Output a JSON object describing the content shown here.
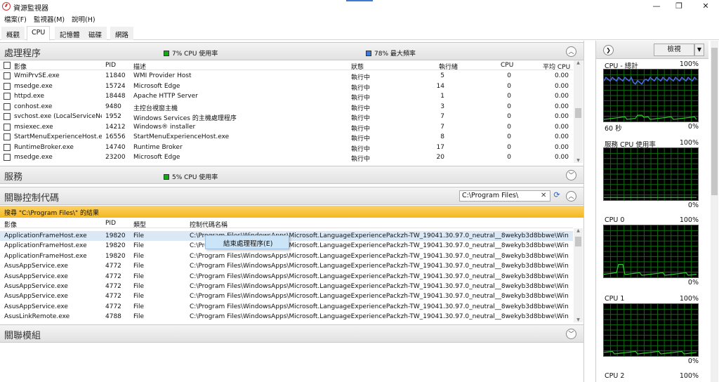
{
  "window": {
    "title": "資源監視器",
    "minimize": "—",
    "maximize": "❐",
    "close": "✕"
  },
  "menu": [
    "檔案(F)",
    "監視器(M)",
    "說明(H)"
  ],
  "tabs": [
    "概觀",
    "CPU",
    "記憶體",
    "磁碟",
    "網路"
  ],
  "processes": {
    "title": "處理程序",
    "cpu_usage": "7% CPU 使用率",
    "max_freq": "78% 最大頻率",
    "cpu_color": "#17a717",
    "freq_color": "#3a7bd5",
    "columns": [
      "影像",
      "PID",
      "描述",
      "狀態",
      "執行緒",
      "CPU",
      "平均 CPU"
    ],
    "rows": [
      [
        "WmiPrvSE.exe",
        "11840",
        "WMI Provider Host",
        "執行中",
        "5",
        "0",
        "0.00"
      ],
      [
        "msedge.exe",
        "15724",
        "Microsoft Edge",
        "執行中",
        "14",
        "0",
        "0.00"
      ],
      [
        "httpd.exe",
        "18448",
        "Apache HTTP Server",
        "執行中",
        "1",
        "0",
        "0.00"
      ],
      [
        "conhost.exe",
        "9480",
        "主控台視窗主機",
        "執行中",
        "3",
        "0",
        "0.00"
      ],
      [
        "svchost.exe (LocalServiceNet...",
        "1952",
        "Windows Services 的主機處理程序",
        "執行中",
        "7",
        "0",
        "0.00"
      ],
      [
        "msiexec.exe",
        "14212",
        "Windows® installer",
        "執行中",
        "7",
        "0",
        "0.00"
      ],
      [
        "StartMenuExperienceHost.exe",
        "16556",
        "StartMenuExperienceHost.exe",
        "執行中",
        "8",
        "0",
        "0.00"
      ],
      [
        "RuntimeBroker.exe",
        "14740",
        "Runtime Broker",
        "執行中",
        "17",
        "0",
        "0.00"
      ],
      [
        "msedge.exe",
        "23200",
        "Microsoft Edge",
        "執行中",
        "20",
        "0",
        "0.00"
      ]
    ]
  },
  "services": {
    "title": "服務",
    "cpu_usage": "5% CPU 使用率"
  },
  "handles": {
    "title": "關聯控制代碼",
    "search_value": "C:\\Program Files\\",
    "clear_icon": "✕",
    "refresh_icon": "⟳",
    "result_text": "搜尋 \"C:\\Program Files\\\" 的結果",
    "columns": [
      "影像",
      "PID",
      "類型",
      "控制代碼名稱"
    ],
    "rows": [
      [
        "ApplicationFrameHost.exe",
        "19820",
        "File",
        "C:\\Program Files\\WindowsApps\\Microsoft.LanguageExperiencePackzh-TW_19041.30.97.0_neutral__8wekyb3d8bbwe\\Windows\\Syste..."
      ],
      [
        "ApplicationFrameHost.exe",
        "19820",
        "File",
        "C:\\Program Files\\WindowsApps\\Microsoft.LanguageExperiencePackzh-TW_19041.30.97.0_neutral__8wekyb3d8bbwe\\Windows\\Syste..."
      ],
      [
        "ApplicationFrameHost.exe",
        "19820",
        "File",
        "C:\\Program Files\\WindowsApps\\Microsoft.LanguageExperiencePackzh-TW_19041.30.97.0_neutral__8wekyb3d8bbwe\\Windows\\Syste..."
      ],
      [
        "AsusAppService.exe",
        "4772",
        "File",
        "C:\\Program Files\\WindowsApps\\Microsoft.LanguageExperiencePackzh-TW_19041.30.97.0_neutral__8wekyb3d8bbwe\\Windows\\Syste..."
      ],
      [
        "AsusAppService.exe",
        "4772",
        "File",
        "C:\\Program Files\\WindowsApps\\Microsoft.LanguageExperiencePackzh-TW_19041.30.97.0_neutral__8wekyb3d8bbwe\\Windows\\Syste..."
      ],
      [
        "AsusAppService.exe",
        "4772",
        "File",
        "C:\\Program Files\\WindowsApps\\Microsoft.LanguageExperiencePackzh-TW_19041.30.97.0_neutral__8wekyb3d8bbwe\\Windows\\Syste..."
      ],
      [
        "AsusAppService.exe",
        "4772",
        "File",
        "C:\\Program Files\\WindowsApps\\Microsoft.LanguageExperiencePackzh-TW_19041.30.97.0_neutral__8wekyb3d8bbwe\\Windows\\Syste..."
      ],
      [
        "AsusAppService.exe",
        "4772",
        "File",
        "C:\\Program Files\\WindowsApps\\Microsoft.LanguageExperiencePackzh-TW_19041.30.97.0_neutral__8wekyb3d8bbwe\\Windows\\Syste..."
      ],
      [
        "AsusLinkRemote.exe",
        "4788",
        "File",
        "C:\\Program Files\\WindowsApps\\Microsoft.LanguageExperiencePackzh-TW_19041.30.97.0_neutral__8wekyb3d8bbwe\\Windows\\Syste..."
      ]
    ],
    "context_menu": "結束處理程序(E)"
  },
  "modules": {
    "title": "關聯模組"
  },
  "right_panel": {
    "view_label": "檢視",
    "graphs": [
      {
        "title": "CPU - 總計",
        "max": "100%",
        "time": "60 秒",
        "min": "0%"
      },
      {
        "title": "服務 CPU 使用率",
        "max": "100%",
        "min": "0%"
      },
      {
        "title": "CPU 0",
        "max": "100%",
        "min": "0%"
      },
      {
        "title": "CPU 1",
        "max": "100%",
        "min": "0%"
      },
      {
        "title": "CPU 2",
        "max": "100%"
      }
    ],
    "grid_color": "#0f6b0f",
    "line_green": "#2ecc2e",
    "line_blue": "#4a6cf0"
  }
}
